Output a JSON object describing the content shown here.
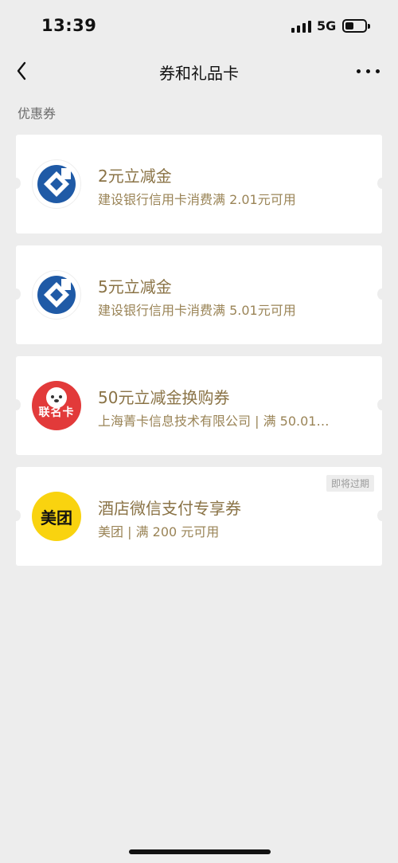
{
  "status_bar": {
    "time": "13:39",
    "network": "5G",
    "battery_level": 0.45
  },
  "nav": {
    "title": "券和礼品卡",
    "back_icon": "chevron-left-icon",
    "more_icon": "more-dots-icon"
  },
  "section": {
    "title": "优惠券"
  },
  "coupons": [
    {
      "title": "2元立减金",
      "subtitle": "建设银行信用卡消费满 2.01元可用",
      "logo": "ccb-logo"
    },
    {
      "title": "5元立减金",
      "subtitle": "建设银行信用卡消费满 5.01元可用",
      "logo": "ccb-logo"
    },
    {
      "title": "50元立减金换购券",
      "subtitle": "上海菁卡信息技术有限公司 | 满 50.01…",
      "logo": "lianmingka-logo",
      "logo_text": "联名卡"
    },
    {
      "title": "酒店微信支付专享券",
      "subtitle": "美团 | 满 200 元可用",
      "logo": "meituan-logo",
      "logo_text": "美团",
      "badge": "即将过期"
    }
  ],
  "colors": {
    "background": "#ededed",
    "card": "#ffffff",
    "coupon_text": "#8a7346",
    "ccb_blue": "#1f5aa6",
    "meituan_yellow": "#f9d30f",
    "lianmingka_red": "#e23a3a"
  }
}
